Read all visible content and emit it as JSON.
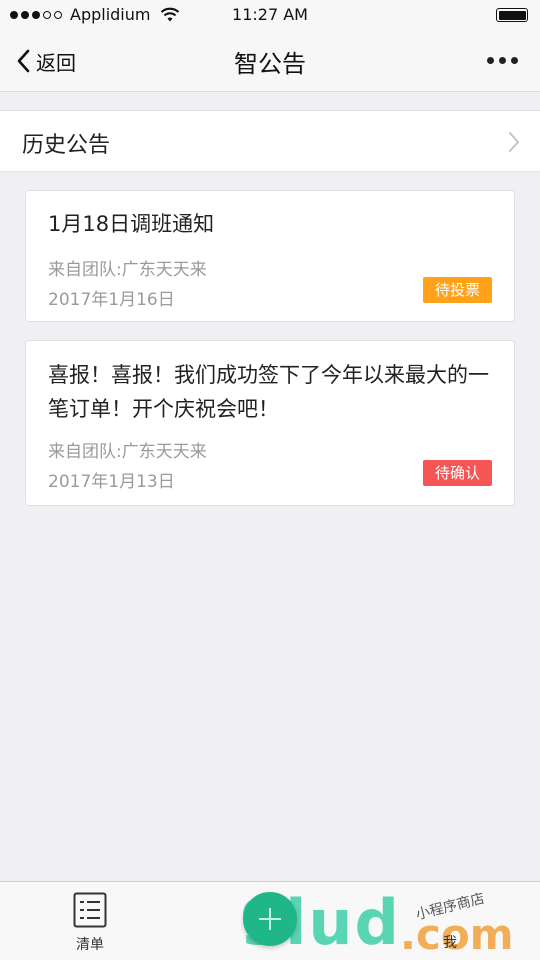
{
  "status_bar": {
    "carrier": "Applidium",
    "time": "11:27 AM"
  },
  "nav": {
    "back_label": "返回",
    "title": "智公告"
  },
  "history": {
    "label": "历史公告"
  },
  "announcements": [
    {
      "title": "1月18日调班通知",
      "team": "来自团队:广东天天来",
      "date": "2017年1月16日",
      "status": "待投票",
      "status_color": "#ffa21a"
    },
    {
      "title": "喜报！喜报！我们成功签下了今年以来最大的一笔订单！开个庆祝会吧！",
      "team": "来自团队:广东天天来",
      "date": "2017年1月13日",
      "status": "待确认",
      "status_color": "#f55555"
    }
  ],
  "tab_bar": {
    "list_label": "清单",
    "me_label": "我",
    "fab_icon": "plus-icon"
  },
  "watermark": {
    "brand": "9lud",
    "domain": ".com",
    "handwriting": "小程序商店"
  }
}
